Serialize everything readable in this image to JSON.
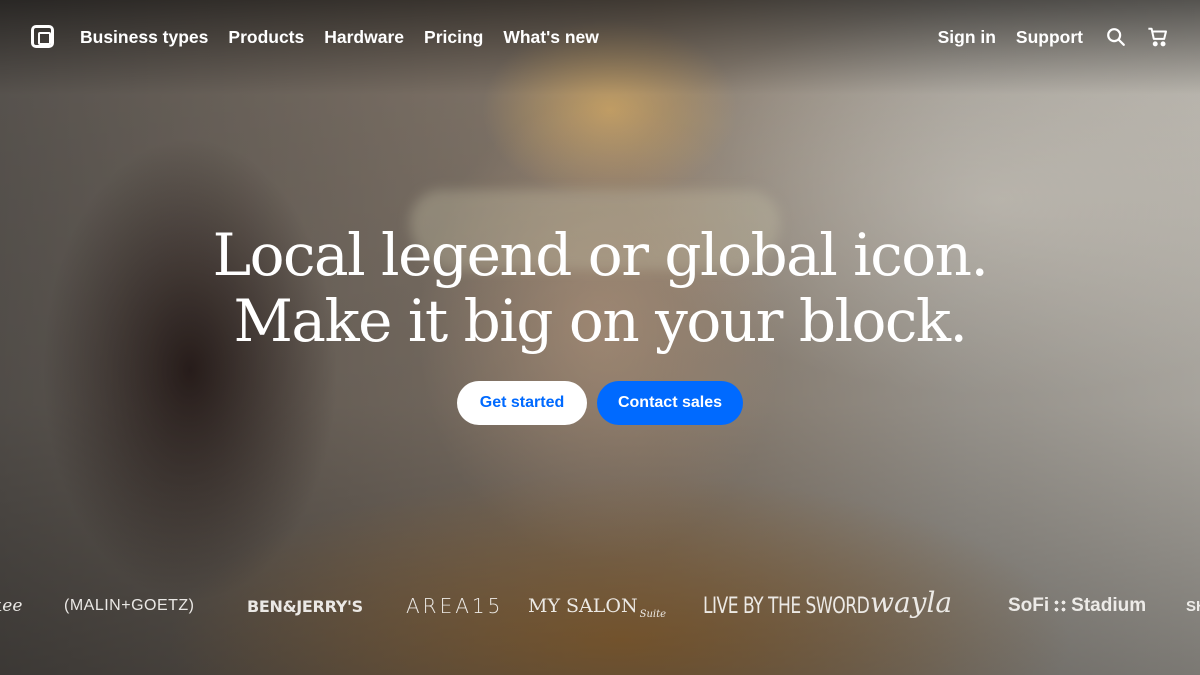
{
  "nav": {
    "left_links": [
      "Business types",
      "Products",
      "Hardware",
      "Pricing",
      "What's new"
    ],
    "right_links": [
      "Sign in",
      "Support"
    ],
    "icons": [
      "square-logo-icon",
      "search-icon",
      "cart-icon"
    ]
  },
  "hero": {
    "headline_line1": "Local legend or global icon.",
    "headline_line2": "Make it big on your block.",
    "primary_button": "Get started",
    "secondary_button": "Contact sales"
  },
  "brands": {
    "nike": "kee",
    "malin": "(MALIN+GOETZ)",
    "ben": "BEN&JERRY'S",
    "area": "AREA15",
    "salon": "MY SALON",
    "salon_sub": "Suite",
    "sword": "LIVE BY THE SWORD",
    "wayla": "wayla",
    "sofi_a": "SoFi",
    "sofi_b": "Stadium",
    "sh": "SH"
  },
  "colors": {
    "accent": "#006aff",
    "text": "#ffffff"
  }
}
